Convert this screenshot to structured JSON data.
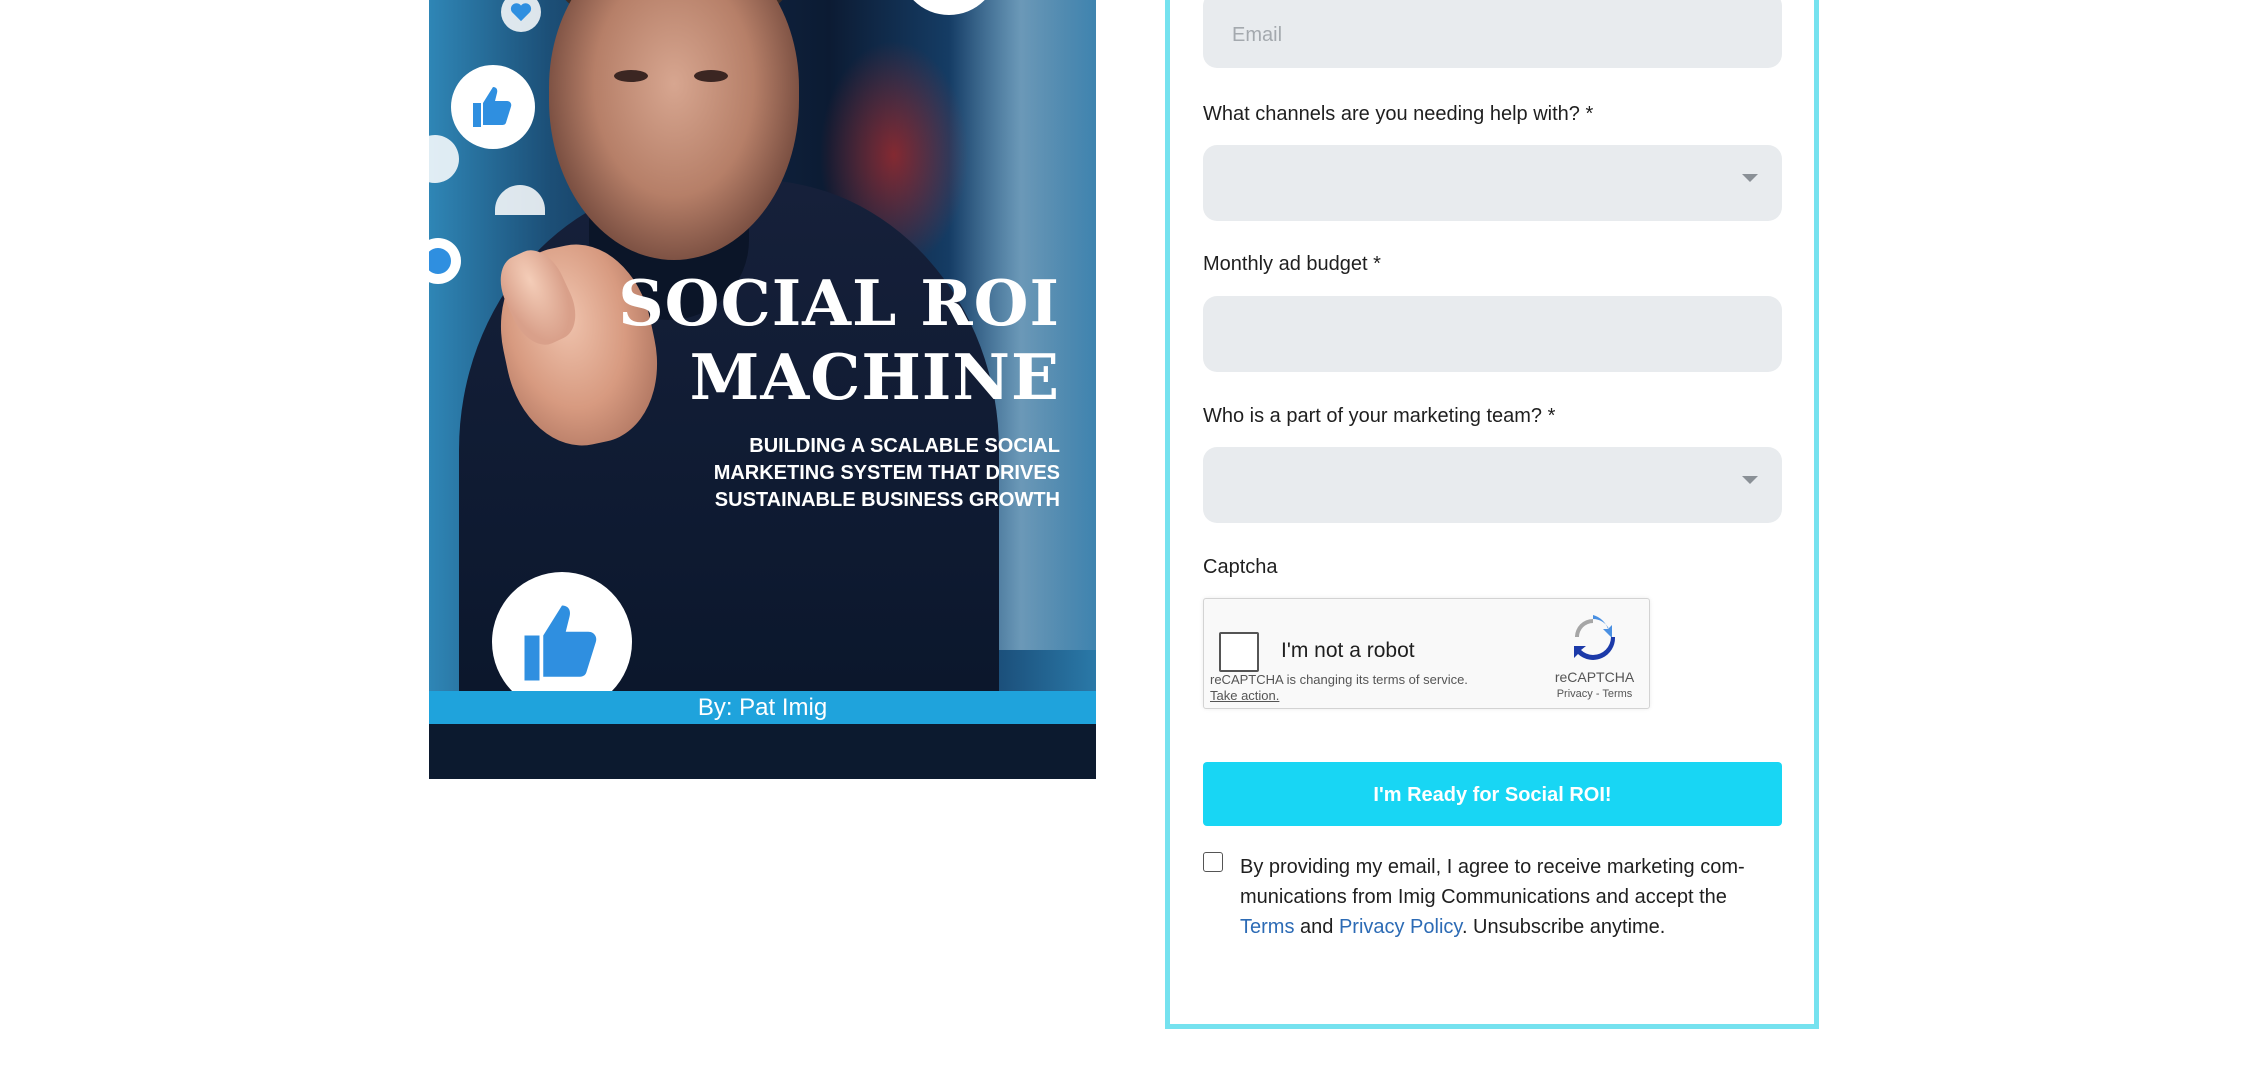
{
  "cover": {
    "title_line1": "SOCIAL ROI",
    "title_line2": "MACHINE",
    "subtitle_line1": "BUILDING A SCALABLE SOCIAL",
    "subtitle_line2": "MARKETING SYSTEM THAT DRIVES",
    "subtitle_line3": "SUSTAINABLE BUSINESS GROWTH",
    "byline": "By: Pat Imig",
    "accent_color": "#1fa3dc"
  },
  "form": {
    "email_placeholder": "Email",
    "channels_label": "What channels are you needing help with? *",
    "budget_label": "Monthly ad budget *",
    "team_label": "Who is a part of your marketing team? *",
    "captcha_label": "Captcha",
    "submit_label": "I'm Ready for Social ROI!",
    "border_color": "#75e2ef",
    "button_color": "#18d6f4"
  },
  "captcha": {
    "checkbox_text": "I'm not a robot",
    "notice": "reCAPTCHA is changing its terms of service.",
    "action_link": "Take action.",
    "brand": "reCAPTCHA",
    "privacy": "Privacy",
    "separator": " - ",
    "terms": "Terms"
  },
  "consent": {
    "text_before": "By providing my email, I agree to receive marketing com-munications from Imig Communications and accept the ",
    "terms_link": "Terms",
    "and": " and ",
    "privacy_link": "Privacy Policy",
    "text_after": ". Unsubscribe anytime.",
    "link_color": "#2c6bb5"
  }
}
